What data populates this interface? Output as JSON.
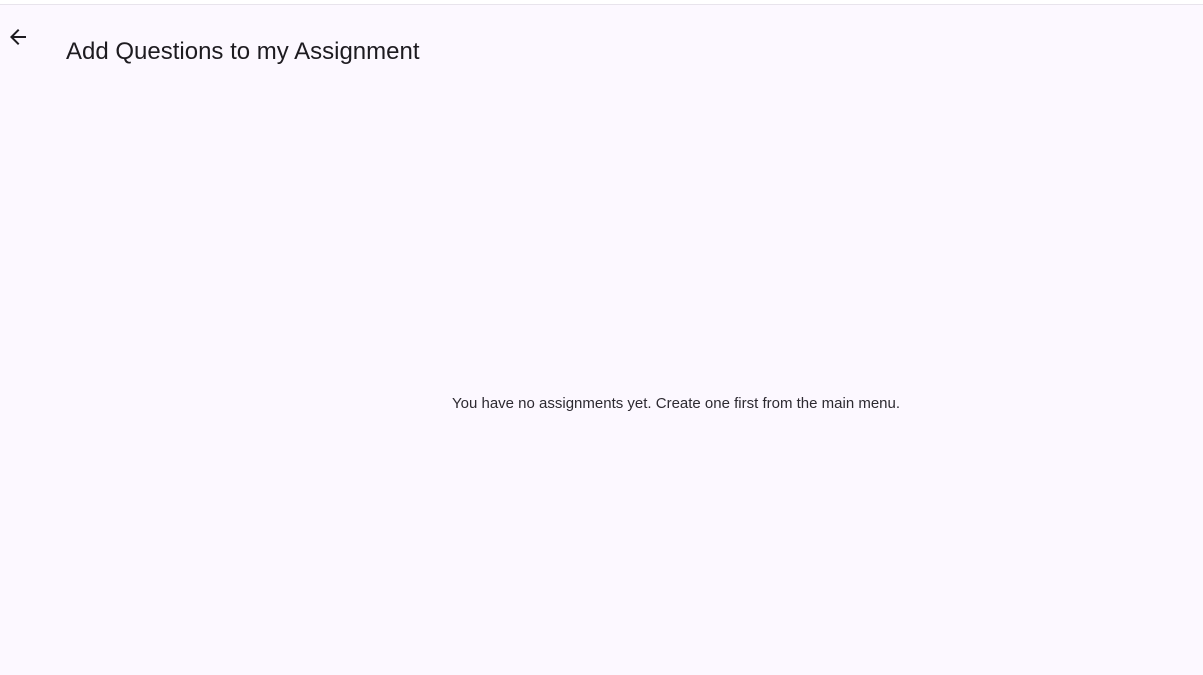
{
  "app_bar": {
    "back_icon": "arrow-back-icon",
    "title": "Add Questions to my Assignment"
  },
  "main": {
    "empty_message": "You have no assignments yet. Create one first from the main menu."
  },
  "colors": {
    "background": "#fcf8ff",
    "text": "#1d1b20",
    "divider": "#e8e4ec"
  }
}
